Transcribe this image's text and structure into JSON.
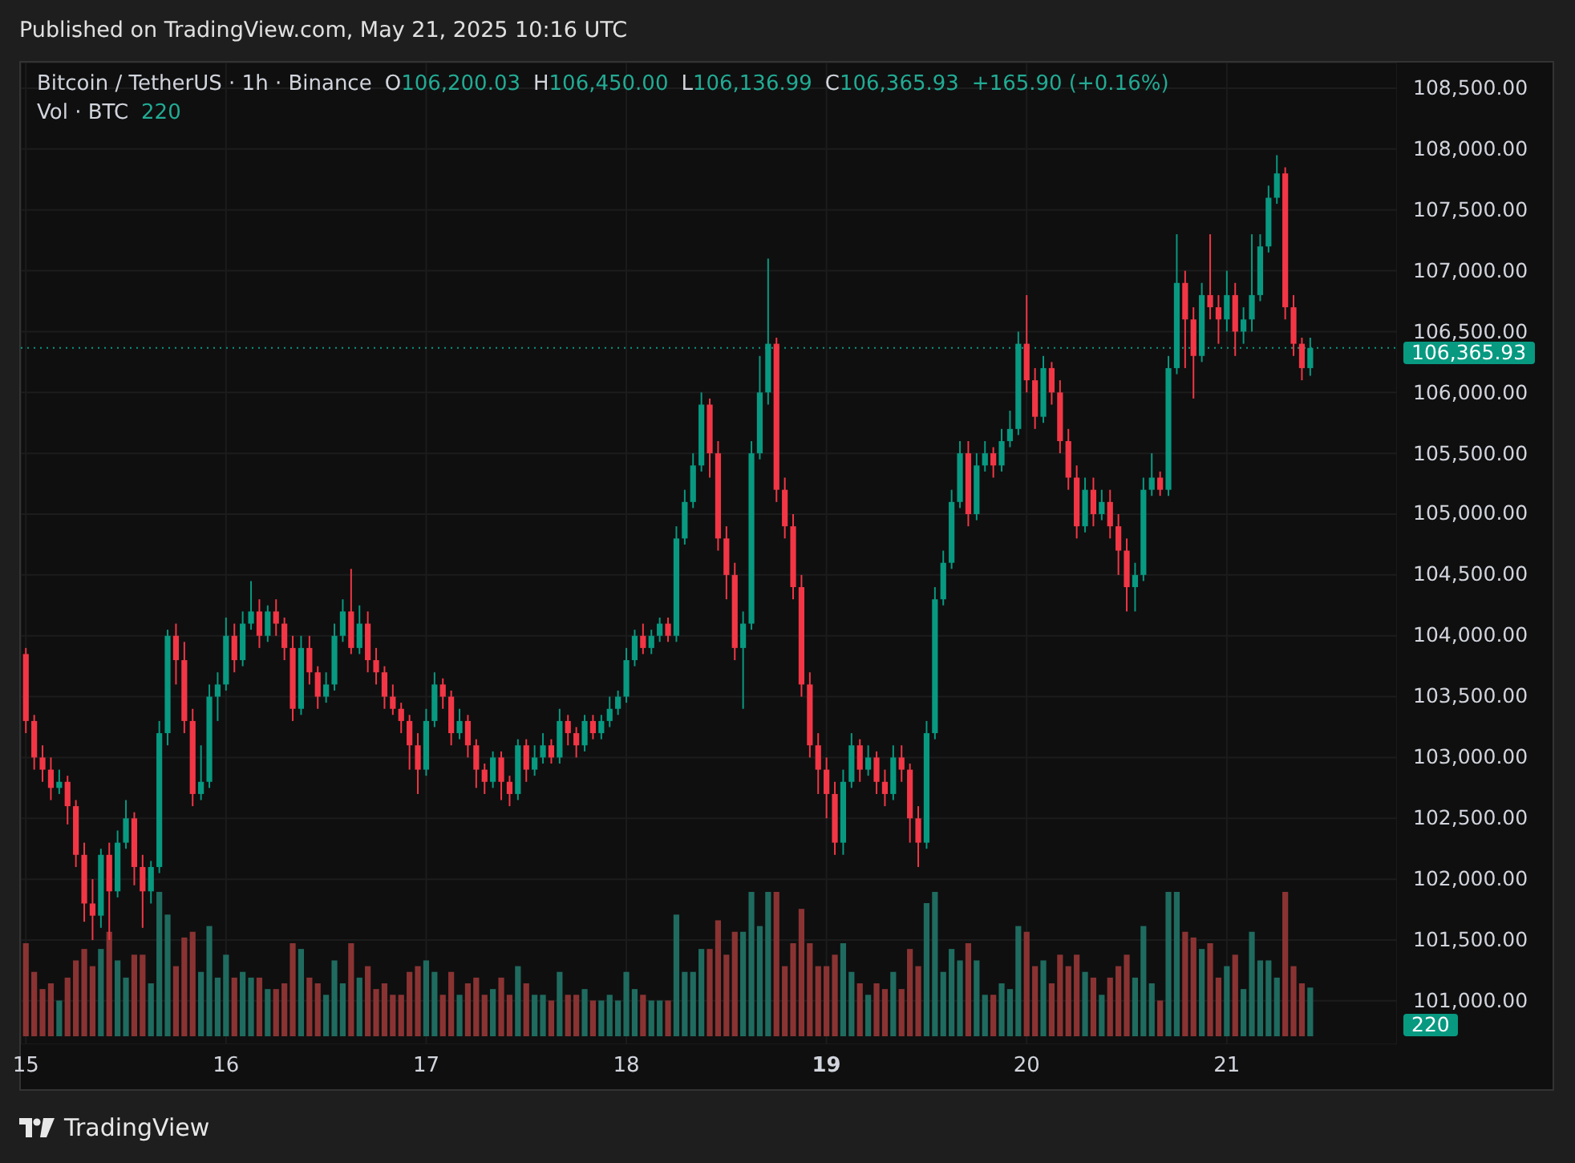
{
  "header": {
    "published": "Published on TradingView.com, May 21, 2025 10:16 UTC"
  },
  "legend": {
    "symbol": "Bitcoin / TetherUS · 1h · Binance",
    "ohlc": [
      {
        "label": "O",
        "value": "106,200.03"
      },
      {
        "label": "H",
        "value": "106,450.00"
      },
      {
        "label": "L",
        "value": "106,136.99"
      },
      {
        "label": "C",
        "value": "106,365.93"
      }
    ],
    "change": "+165.90 (+0.16%)",
    "volume_label": "Vol · BTC",
    "volume_value": "220"
  },
  "price_chart": {
    "chart_data": {
      "type": "candlestick",
      "ylim": [
        100643,
        108711
      ],
      "grid": true,
      "xlim": [
        14.975,
        21.85
      ],
      "ref_lines": [
        {
          "axis": "y",
          "value": 106365.93,
          "label": "106,365.93"
        }
      ],
      "xticks": [
        {
          "value": 15,
          "label": "15"
        },
        {
          "value": 16,
          "label": "16"
        },
        {
          "value": 17,
          "label": "17"
        },
        {
          "value": 18,
          "label": "18"
        },
        {
          "value": 19,
          "label": "19"
        },
        {
          "value": 20,
          "label": "20"
        },
        {
          "value": 21,
          "label": "21"
        }
      ],
      "yticks": [
        {
          "value": 108500,
          "label": "108,500.00"
        },
        {
          "value": 108000,
          "label": "108,000.00"
        },
        {
          "value": 107500,
          "label": "107,500.00"
        },
        {
          "value": 107000,
          "label": "107,000.00"
        },
        {
          "value": 106500,
          "label": "106,500.00"
        },
        {
          "value": 106000,
          "label": "106,000.00"
        },
        {
          "value": 105500,
          "label": "105,500.00"
        },
        {
          "value": 105000,
          "label": "105,000.00"
        },
        {
          "value": 104500,
          "label": "104,500.00"
        },
        {
          "value": 104000,
          "label": "104,000.00"
        },
        {
          "value": 103500,
          "label": "103,500.00"
        },
        {
          "value": 103000,
          "label": "103,000.00"
        },
        {
          "value": 102500,
          "label": "102,500.00"
        },
        {
          "value": 102000,
          "label": "102,000.00"
        },
        {
          "value": 101500,
          "label": "101,500.00"
        },
        {
          "value": 101000,
          "label": "101,000.00"
        }
      ],
      "x": [
        15,
        15.0417,
        15.0833,
        15.125,
        15.1667,
        15.2083,
        15.25,
        15.2917,
        15.3333,
        15.375,
        15.4167,
        15.4583,
        15.5,
        15.5417,
        15.5833,
        15.625,
        15.6667,
        15.7083,
        15.75,
        15.7917,
        15.8333,
        15.875,
        15.9167,
        15.9583,
        16,
        16.0417,
        16.0833,
        16.125,
        16.1667,
        16.2083,
        16.25,
        16.2917,
        16.3333,
        16.375,
        16.4167,
        16.4583,
        16.5,
        16.5417,
        16.5833,
        16.625,
        16.6667,
        16.7083,
        16.75,
        16.7917,
        16.8333,
        16.875,
        16.9167,
        16.9583,
        17,
        17.0417,
        17.0833,
        17.125,
        17.1667,
        17.2083,
        17.25,
        17.2917,
        17.3333,
        17.375,
        17.4167,
        17.4583,
        17.5,
        17.5417,
        17.5833,
        17.625,
        17.6667,
        17.7083,
        17.75,
        17.7917,
        17.8333,
        17.875,
        17.9167,
        17.9583,
        18,
        18.0417,
        18.0833,
        18.125,
        18.1667,
        18.2083,
        18.25,
        18.2917,
        18.3333,
        18.375,
        18.4167,
        18.4583,
        18.5,
        18.5417,
        18.5833,
        18.625,
        18.6667,
        18.7083,
        18.75,
        18.7917,
        18.8333,
        18.875,
        18.9167,
        18.9583,
        19,
        19.0417,
        19.0833,
        19.125,
        19.1667,
        19.2083,
        19.25,
        19.2917,
        19.3333,
        19.375,
        19.4167,
        19.4583,
        19.5,
        19.5417,
        19.5833,
        19.625,
        19.6667,
        19.7083,
        19.75,
        19.7917,
        19.8333,
        19.875,
        19.9167,
        19.9583,
        20,
        20.0417,
        20.0833,
        20.125,
        20.1667,
        20.2083,
        20.25,
        20.2917,
        20.3333,
        20.375,
        20.4167,
        20.4583,
        20.5,
        20.5417,
        20.5833,
        20.625,
        20.6667,
        20.7083,
        20.75,
        20.7917,
        20.8333,
        20.875,
        20.9167,
        20.9583,
        21,
        21.0417,
        21.0833,
        21.125,
        21.1667,
        21.2083,
        21.25,
        21.2917,
        21.3333,
        21.375,
        21.4167
      ],
      "ohlc": [
        [
          103850,
          103900,
          103200,
          103300
        ],
        [
          103300,
          103350,
          102900,
          103000
        ],
        [
          103000,
          103100,
          102800,
          102900
        ],
        [
          102900,
          103000,
          102650,
          102750
        ],
        [
          102750,
          102900,
          102700,
          102800
        ],
        [
          102800,
          102850,
          102450,
          102600
        ],
        [
          102600,
          102650,
          102100,
          102200
        ],
        [
          102200,
          102300,
          101650,
          101800
        ],
        [
          101800,
          102000,
          101500,
          101700
        ],
        [
          101700,
          102250,
          101600,
          102200
        ],
        [
          102200,
          102300,
          101500,
          101900
        ],
        [
          101900,
          102400,
          101850,
          102300
        ],
        [
          102300,
          102650,
          102250,
          102500
        ],
        [
          102500,
          102550,
          101950,
          102100
        ],
        [
          102100,
          102200,
          101600,
          101900
        ],
        [
          101900,
          102150,
          101800,
          102100
        ],
        [
          102100,
          103300,
          102050,
          103200
        ],
        [
          103200,
          104050,
          103100,
          104000
        ],
        [
          104000,
          104100,
          103600,
          103800
        ],
        [
          103800,
          103950,
          103200,
          103300
        ],
        [
          103300,
          103400,
          102600,
          102700
        ],
        [
          102700,
          103100,
          102650,
          102800
        ],
        [
          102800,
          103600,
          102750,
          103500
        ],
        [
          103500,
          103700,
          103300,
          103600
        ],
        [
          103600,
          104150,
          103550,
          104000
        ],
        [
          104000,
          104100,
          103700,
          103800
        ],
        [
          103800,
          104200,
          103750,
          104100
        ],
        [
          104100,
          104450,
          104050,
          104200
        ],
        [
          104200,
          104300,
          103900,
          104000
        ],
        [
          104000,
          104250,
          103950,
          104200
        ],
        [
          104200,
          104300,
          104000,
          104100
        ],
        [
          104100,
          104150,
          103800,
          103900
        ],
        [
          103900,
          104000,
          103300,
          103400
        ],
        [
          103400,
          104000,
          103350,
          103900
        ],
        [
          103900,
          104000,
          103600,
          103700
        ],
        [
          103700,
          103750,
          103400,
          103500
        ],
        [
          103500,
          103700,
          103450,
          103600
        ],
        [
          103600,
          104100,
          103550,
          104000
        ],
        [
          104000,
          104300,
          103950,
          104200
        ],
        [
          104200,
          104550,
          103850,
          103900
        ],
        [
          103900,
          104250,
          103850,
          104100
        ],
        [
          104100,
          104200,
          103700,
          103800
        ],
        [
          103800,
          103900,
          103600,
          103700
        ],
        [
          103700,
          103750,
          103400,
          103500
        ],
        [
          103500,
          103600,
          103350,
          103400
        ],
        [
          103400,
          103450,
          103200,
          103300
        ],
        [
          103300,
          103350,
          102900,
          103100
        ],
        [
          103100,
          103200,
          102700,
          102900
        ],
        [
          102900,
          103400,
          102850,
          103300
        ],
        [
          103300,
          103700,
          103250,
          103600
        ],
        [
          103600,
          103650,
          103400,
          103500
        ],
        [
          103500,
          103550,
          103100,
          103200
        ],
        [
          103200,
          103400,
          103150,
          103300
        ],
        [
          103300,
          103350,
          103000,
          103100
        ],
        [
          103100,
          103150,
          102750,
          102900
        ],
        [
          102900,
          102950,
          102700,
          102800
        ],
        [
          102800,
          103050,
          102750,
          103000
        ],
        [
          103000,
          103050,
          102650,
          102800
        ],
        [
          102800,
          102850,
          102600,
          102700
        ],
        [
          102700,
          103150,
          102650,
          103100
        ],
        [
          103100,
          103150,
          102800,
          102900
        ],
        [
          102900,
          103100,
          102850,
          103000
        ],
        [
          103000,
          103200,
          102950,
          103100
        ],
        [
          103100,
          103150,
          102950,
          103000
        ],
        [
          103000,
          103400,
          102950,
          103300
        ],
        [
          103300,
          103350,
          103100,
          103200
        ],
        [
          103200,
          103250,
          103000,
          103100
        ],
        [
          103100,
          103350,
          103050,
          103300
        ],
        [
          103300,
          103350,
          103150,
          103200
        ],
        [
          103200,
          103350,
          103150,
          103300
        ],
        [
          103300,
          103500,
          103250,
          103400
        ],
        [
          103400,
          103550,
          103350,
          103500
        ],
        [
          103500,
          103900,
          103450,
          103800
        ],
        [
          103800,
          104050,
          103750,
          104000
        ],
        [
          104000,
          104100,
          103850,
          103900
        ],
        [
          103900,
          104050,
          103850,
          104000
        ],
        [
          104000,
          104150,
          103950,
          104100
        ],
        [
          104100,
          104150,
          103950,
          104000
        ],
        [
          104000,
          104900,
          103950,
          104800
        ],
        [
          104800,
          105200,
          104750,
          105100
        ],
        [
          105100,
          105500,
          105050,
          105400
        ],
        [
          105400,
          106000,
          105350,
          105900
        ],
        [
          105900,
          105950,
          105300,
          105500
        ],
        [
          105500,
          105600,
          104700,
          104800
        ],
        [
          104800,
          104900,
          104300,
          104500
        ],
        [
          104500,
          104600,
          103800,
          103900
        ],
        [
          103900,
          104200,
          103400,
          104100
        ],
        [
          104100,
          105600,
          104050,
          105500
        ],
        [
          105500,
          106300,
          105450,
          106000
        ],
        [
          106000,
          107100,
          105900,
          106400
        ],
        [
          106400,
          106450,
          105100,
          105200
        ],
        [
          105200,
          105300,
          104800,
          104900
        ],
        [
          104900,
          105000,
          104300,
          104400
        ],
        [
          104400,
          104500,
          103500,
          103600
        ],
        [
          103600,
          103700,
          103000,
          103100
        ],
        [
          103100,
          103200,
          102700,
          102900
        ],
        [
          102900,
          103000,
          102500,
          102700
        ],
        [
          102700,
          102800,
          102200,
          102300
        ],
        [
          102300,
          102900,
          102200,
          102800
        ],
        [
          102800,
          103200,
          102750,
          103100
        ],
        [
          103100,
          103150,
          102800,
          102900
        ],
        [
          102900,
          103100,
          102850,
          103000
        ],
        [
          103000,
          103050,
          102700,
          102800
        ],
        [
          102800,
          102900,
          102600,
          102700
        ],
        [
          102700,
          103100,
          102650,
          103000
        ],
        [
          103000,
          103100,
          102800,
          102900
        ],
        [
          102900,
          102950,
          102300,
          102500
        ],
        [
          102500,
          102600,
          102100,
          102300
        ],
        [
          102300,
          103300,
          102250,
          103200
        ],
        [
          103200,
          104400,
          103150,
          104300
        ],
        [
          104300,
          104700,
          104250,
          104600
        ],
        [
          104600,
          105200,
          104550,
          105100
        ],
        [
          105100,
          105600,
          105050,
          105500
        ],
        [
          105500,
          105600,
          104900,
          105000
        ],
        [
          105000,
          105500,
          104950,
          105400
        ],
        [
          105400,
          105600,
          105350,
          105500
        ],
        [
          105500,
          105550,
          105300,
          105400
        ],
        [
          105400,
          105700,
          105350,
          105600
        ],
        [
          105600,
          105850,
          105550,
          105700
        ],
        [
          105700,
          106500,
          105650,
          106400
        ],
        [
          106400,
          106800,
          106000,
          106100
        ],
        [
          106100,
          106200,
          105700,
          105800
        ],
        [
          105800,
          106300,
          105750,
          106200
        ],
        [
          106200,
          106250,
          105900,
          106000
        ],
        [
          106000,
          106100,
          105500,
          105600
        ],
        [
          105600,
          105700,
          105200,
          105300
        ],
        [
          105300,
          105400,
          104800,
          104900
        ],
        [
          104900,
          105300,
          104850,
          105200
        ],
        [
          105200,
          105300,
          104900,
          105000
        ],
        [
          105000,
          105200,
          104950,
          105100
        ],
        [
          105100,
          105200,
          104800,
          104900
        ],
        [
          104900,
          105000,
          104500,
          104700
        ],
        [
          104700,
          104800,
          104200,
          104400
        ],
        [
          104400,
          104600,
          104200,
          104500
        ],
        [
          104500,
          105300,
          104450,
          105200
        ],
        [
          105200,
          105500,
          105150,
          105300
        ],
        [
          105300,
          105350,
          105150,
          105200
        ],
        [
          105200,
          106300,
          105150,
          106200
        ],
        [
          106200,
          107300,
          106150,
          106900
        ],
        [
          106900,
          107000,
          106200,
          106600
        ],
        [
          106600,
          106700,
          105950,
          106300
        ],
        [
          106300,
          106900,
          106250,
          106800
        ],
        [
          106800,
          107300,
          106600,
          106700
        ],
        [
          106700,
          106800,
          106400,
          106600
        ],
        [
          106600,
          107000,
          106500,
          106800
        ],
        [
          106800,
          106900,
          106300,
          106500
        ],
        [
          106500,
          106700,
          106400,
          106600
        ],
        [
          106600,
          107300,
          106500,
          106800
        ],
        [
          106800,
          107300,
          106750,
          107200
        ],
        [
          107200,
          107700,
          107150,
          107600
        ],
        [
          107600,
          107950,
          107550,
          107800
        ],
        [
          107800,
          107850,
          106600,
          106700
        ],
        [
          106700,
          106800,
          106300,
          106400
        ],
        [
          106400,
          106450,
          106100,
          106200
        ],
        [
          106200.03,
          106450,
          106136.99,
          106365.93
        ]
      ]
    }
  },
  "volume_badge": "220",
  "time_axis": [
    {
      "emphasized": false
    },
    {
      "emphasized": false
    },
    {
      "emphasized": false
    },
    {
      "emphasized": false
    },
    {
      "emphasized": true
    },
    {
      "emphasized": false
    },
    {
      "emphasized": false
    }
  ],
  "footer": {
    "brand": "TradingView"
  }
}
